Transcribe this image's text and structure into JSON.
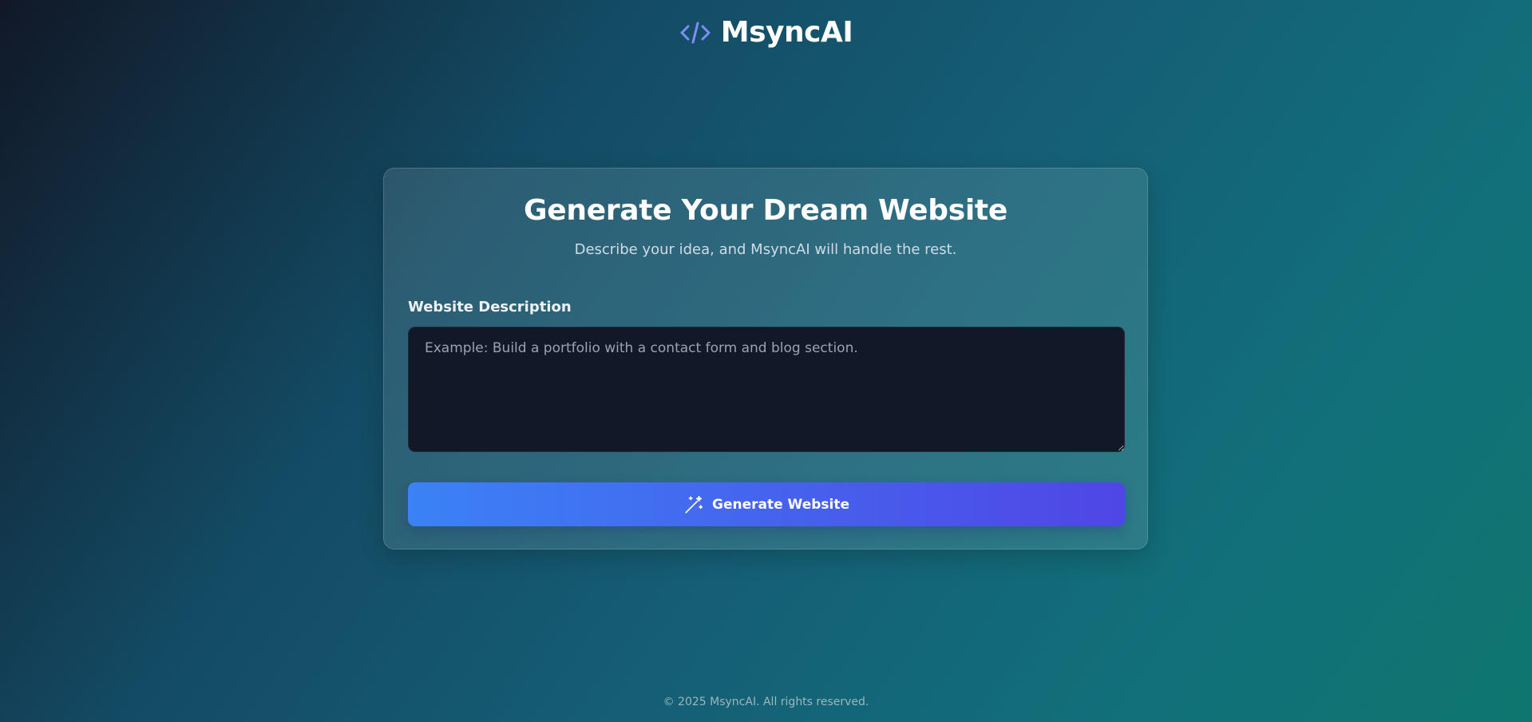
{
  "header": {
    "icon": "code-icon",
    "icon_color": "#818cf8",
    "title": "MsyncAI"
  },
  "card": {
    "title": "Generate Your Dream Website",
    "subtitle": "Describe your idea, and MsyncAI will handle the rest.",
    "field_label": "Website Description",
    "textarea": {
      "value": "",
      "placeholder": "Example: Build a portfolio with a contact form and blog section."
    },
    "button": {
      "icon": "magic-wand-icon",
      "label": "Generate Website",
      "gradient": [
        "#3b82f6",
        "#4f46e5"
      ]
    }
  },
  "footer": {
    "text": "© 2025 MsyncAI. All rights reserved."
  }
}
